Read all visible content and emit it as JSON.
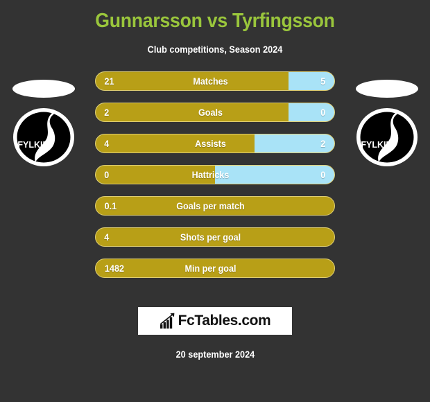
{
  "header": {
    "title": "Gunnarsson vs Tyrfingsson",
    "subtitle": "Club competitions, Season 2024"
  },
  "teams": {
    "home": {
      "crest_name": "fylkir-crest",
      "crest_text": "FYLKIR"
    },
    "away": {
      "crest_name": "fylkir-crest",
      "crest_text": "FYLKIR"
    }
  },
  "colors": {
    "background": "#333333",
    "title_green": "#9ac63c",
    "home_gold": "#b89f17",
    "away_blue": "#a9e3f7",
    "border_gold": "#e0cf73",
    "text_white": "#ffffff"
  },
  "chart_data": {
    "type": "bar",
    "title": "Gunnarsson vs Tyrfingsson",
    "subtitle": "Club competitions, Season 2024",
    "categories": [
      "Matches",
      "Goals",
      "Assists",
      "Hattricks",
      "Goals per match",
      "Shots per goal",
      "Min per goal"
    ],
    "series": [
      {
        "name": "Gunnarsson",
        "values": [
          "21",
          "2",
          "4",
          "0",
          "0.1",
          "4",
          "1482"
        ]
      },
      {
        "name": "Tyrfingsson",
        "values": [
          "5",
          "0",
          "2",
          "0",
          null,
          null,
          null
        ]
      }
    ],
    "legend": "position: implicit (left = home gold, right = away blue)",
    "grid": false
  },
  "rows": [
    {
      "label": "Matches",
      "home": "21",
      "away": "5",
      "home_pct": 80.8,
      "split": true
    },
    {
      "label": "Goals",
      "home": "2",
      "away": "0",
      "home_pct": 80.8,
      "split": true
    },
    {
      "label": "Assists",
      "home": "4",
      "away": "2",
      "home_pct": 66.6,
      "split": true
    },
    {
      "label": "Hattricks",
      "home": "0",
      "away": "0",
      "home_pct": 50.0,
      "split": true
    },
    {
      "label": "Goals per match",
      "home": "0.1",
      "away": "",
      "home_pct": 100,
      "split": false
    },
    {
      "label": "Shots per goal",
      "home": "4",
      "away": "",
      "home_pct": 100,
      "split": false
    },
    {
      "label": "Min per goal",
      "home": "1482",
      "away": "",
      "home_pct": 100,
      "split": false
    }
  ],
  "footer": {
    "logo_text": "FcTables.com",
    "logo_icon": "bar-chart-arrow-icon",
    "date": "20 september 2024"
  }
}
